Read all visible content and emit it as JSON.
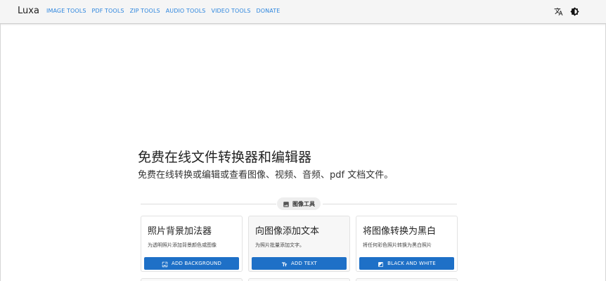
{
  "header": {
    "brand": "Luxa",
    "nav": [
      {
        "label": "IMAGE TOOLS"
      },
      {
        "label": "PDF TOOLS"
      },
      {
        "label": "ZIP TOOLS"
      },
      {
        "label": "AUDIO TOOLS"
      },
      {
        "label": "VIDEO TOOLS"
      },
      {
        "label": "DONATE"
      }
    ],
    "icons": {
      "language": "translate-icon",
      "theme": "brightness-icon"
    }
  },
  "hero": {
    "title": "免费在线文件转换器和编辑器",
    "subtitle": "免费在线转换或编辑或查看图像、视频、音频、pdf 文档文件。"
  },
  "section": {
    "chip_label": "图像工具",
    "chip_icon": "image-icon"
  },
  "cards": [
    {
      "title": "照片背景加法器",
      "description": "为透明照片添加背景颜色或图像",
      "button": "ADD BACKGROUND",
      "button_icon": "wallpaper-icon"
    },
    {
      "title": "向图像添加文本",
      "description": "为照片批量添加文字。",
      "button": "ADD TEXT",
      "button_icon": "text-icon"
    },
    {
      "title": "将图像转换为黑白",
      "description": "将任何彩色照片转换为黑白照片",
      "button": "BLACK AND WHITE",
      "button_icon": "contrast-icon"
    }
  ],
  "colors": {
    "nav_link": "#2e86de",
    "button": "#1e70c7",
    "navbar_bg": "#f5f5f5"
  }
}
